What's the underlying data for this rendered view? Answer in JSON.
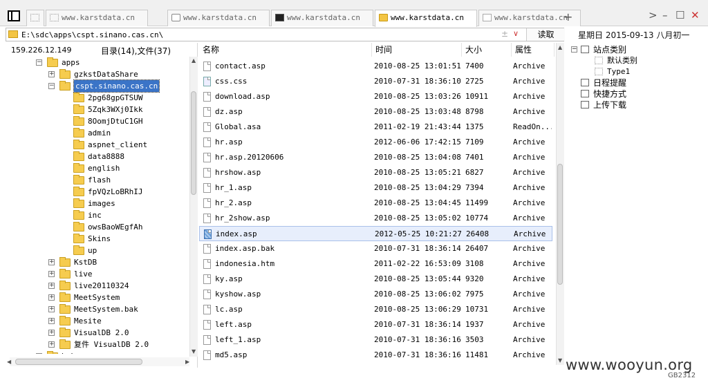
{
  "tabs": [
    {
      "label": "",
      "icon": "blank-page-icon"
    },
    {
      "label": "www.karstdata.cn",
      "icon": "dotted-page-icon"
    },
    {
      "label": "www.karstdata.cn",
      "icon": "page-icon"
    },
    {
      "label": "www.karstdata.cn",
      "icon": "terminal-icon"
    },
    {
      "label": "www.karstdata.cn",
      "icon": "folder-icon",
      "active": true
    },
    {
      "label": "www.karstdata.cn",
      "icon": "document-icon"
    }
  ],
  "window": {
    "new_tab": "+",
    "next": ">",
    "minimize": "–",
    "maximize": "☐",
    "close": "✕"
  },
  "address": {
    "path": "E:\\sdc\\apps\\cspt.sinano.cas.cn\\",
    "plus_minus": "±",
    "dropdown": "∨",
    "read_button": "读取"
  },
  "date": "星期日  2015-09-13  八月初一",
  "left": {
    "ip": "159.226.12.149",
    "summary": "目录(14),文件(37)",
    "tree": [
      {
        "label": "apps",
        "depth": 1,
        "exp": "−"
      },
      {
        "label": "gzkstDataShare",
        "depth": 2,
        "exp": "+"
      },
      {
        "label": "cspt.sinano.cas.cn",
        "depth": 2,
        "exp": "−",
        "selected": true
      },
      {
        "label": "2pg68gpGTSUW",
        "depth": 3
      },
      {
        "label": "5Zqk3WXj0Ikk",
        "depth": 3
      },
      {
        "label": "8OomjDtuC1GH",
        "depth": 3
      },
      {
        "label": "admin",
        "depth": 3
      },
      {
        "label": "aspnet_client",
        "depth": 3
      },
      {
        "label": "data8888",
        "depth": 3
      },
      {
        "label": "english",
        "depth": 3
      },
      {
        "label": "flash",
        "depth": 3
      },
      {
        "label": "fpVQzLoBRhIJ",
        "depth": 3
      },
      {
        "label": "images",
        "depth": 3
      },
      {
        "label": "inc",
        "depth": 3
      },
      {
        "label": "owsBaoWEgfAh",
        "depth": 3
      },
      {
        "label": "Skins",
        "depth": 3
      },
      {
        "label": "up",
        "depth": 3
      },
      {
        "label": "KstDB",
        "depth": 2,
        "exp": "+"
      },
      {
        "label": "live",
        "depth": 2,
        "exp": "+"
      },
      {
        "label": "live20110324",
        "depth": 2,
        "exp": "+"
      },
      {
        "label": "MeetSystem",
        "depth": 2,
        "exp": "+"
      },
      {
        "label": "MeetSystem.bak",
        "depth": 2,
        "exp": "+"
      },
      {
        "label": "Mesite",
        "depth": 2,
        "exp": "+"
      },
      {
        "label": "VisualDB 2.0",
        "depth": 2,
        "exp": "+"
      },
      {
        "label": "复件 VisualDB 2.0",
        "depth": 2,
        "exp": "+"
      },
      {
        "label": "bak",
        "depth": 1,
        "exp": "−"
      }
    ]
  },
  "files": {
    "headers": {
      "name": "名称",
      "time": "时间",
      "size": "大小",
      "attr": "属性"
    },
    "rows": [
      {
        "name": "contact.asp",
        "time": "2010-08-25 13:01:51",
        "size": "7400",
        "attr": "Archive"
      },
      {
        "name": "css.css",
        "time": "2010-07-31 18:36:10",
        "size": "2725",
        "attr": "Archive",
        "icon": "css"
      },
      {
        "name": "download.asp",
        "time": "2010-08-25 13:03:26",
        "size": "10911",
        "attr": "Archive"
      },
      {
        "name": "dz.asp",
        "time": "2010-08-25 13:03:48",
        "size": "8798",
        "attr": "Archive"
      },
      {
        "name": "Global.asa",
        "time": "2011-02-19 21:43:44",
        "size": "1375",
        "attr": "ReadOn..."
      },
      {
        "name": "hr.asp",
        "time": "2012-06-06 17:42:15",
        "size": "7109",
        "attr": "Archive"
      },
      {
        "name": "hr.asp.20120606",
        "time": "2010-08-25 13:04:08",
        "size": "7401",
        "attr": "Archive"
      },
      {
        "name": "hrshow.asp",
        "time": "2010-08-25 13:05:21",
        "size": "6827",
        "attr": "Archive"
      },
      {
        "name": "hr_1.asp",
        "time": "2010-08-25 13:04:29",
        "size": "7394",
        "attr": "Archive"
      },
      {
        "name": "hr_2.asp",
        "time": "2010-08-25 13:04:45",
        "size": "11499",
        "attr": "Archive"
      },
      {
        "name": "hr_2show.asp",
        "time": "2010-08-25 13:05:02",
        "size": "10774",
        "attr": "Archive"
      },
      {
        "name": "index.asp",
        "time": "2012-05-25 10:21:27",
        "size": "26408",
        "attr": "Archive",
        "selected": true
      },
      {
        "name": "index.asp.bak",
        "time": "2010-07-31 18:36:14",
        "size": "26407",
        "attr": "Archive"
      },
      {
        "name": "indonesia.htm",
        "time": "2011-02-22 16:53:09",
        "size": "3108",
        "attr": "Archive"
      },
      {
        "name": "ky.asp",
        "time": "2010-08-25 13:05:44",
        "size": "9320",
        "attr": "Archive"
      },
      {
        "name": "kyshow.asp",
        "time": "2010-08-25 13:06:02",
        "size": "7975",
        "attr": "Archive"
      },
      {
        "name": "lc.asp",
        "time": "2010-08-25 13:06:29",
        "size": "10731",
        "attr": "Archive"
      },
      {
        "name": "left.asp",
        "time": "2010-07-31 18:36:14",
        "size": "1937",
        "attr": "Archive"
      },
      {
        "name": "left_1.asp",
        "time": "2010-07-31 18:36:16",
        "size": "3503",
        "attr": "Archive"
      },
      {
        "name": "md5.asp",
        "time": "2010-07-31 18:36:16",
        "size": "11481",
        "attr": "Archive"
      }
    ]
  },
  "right": {
    "items": [
      {
        "label": "站点类别",
        "exp": "−",
        "icon": "site-category-icon"
      },
      {
        "label": "默认类别",
        "sub": true,
        "icon": "category-icon"
      },
      {
        "label": "Type1",
        "sub": true,
        "icon": "category-icon"
      },
      {
        "label": "日程提醒",
        "icon": "schedule-icon"
      },
      {
        "label": "快捷方式",
        "icon": "shortcut-icon"
      },
      {
        "label": "上传下载",
        "icon": "transfer-icon"
      }
    ]
  },
  "status": "GB2312",
  "watermark": "www.wooyun.org"
}
